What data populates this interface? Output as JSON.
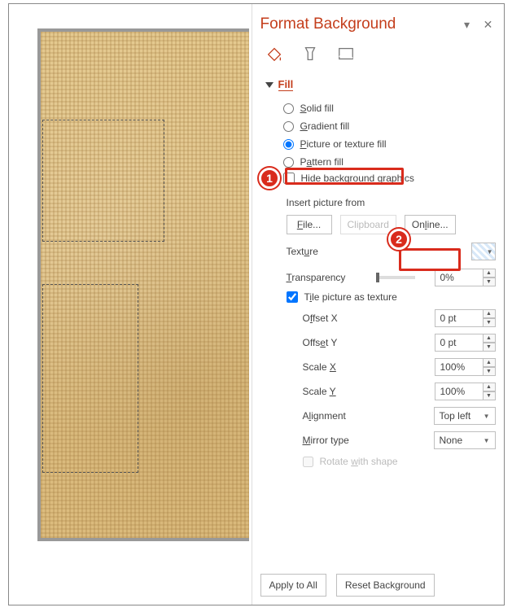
{
  "pane_title": "Format Background",
  "fill_section": {
    "label": "Fill",
    "options": {
      "solid": "Solid fill",
      "gradient": "Gradient fill",
      "picture": "Picture or texture fill",
      "pattern": "Pattern fill"
    },
    "selected": "picture",
    "hide_bg": "Hide background graphics",
    "hide_bg_checked": false
  },
  "insert_picture": {
    "label": "Insert picture from",
    "file_btn": "File...",
    "clipboard_btn": "Clipboard",
    "online_btn": "Online..."
  },
  "texture_label": "Texture",
  "transparency": {
    "label": "Transparency",
    "value": "0%"
  },
  "tile": {
    "label": "Tile picture as texture",
    "checked": true
  },
  "offset_x": {
    "label": "Offset X",
    "value": "0 pt"
  },
  "offset_y": {
    "label": "Offset Y",
    "value": "0 pt"
  },
  "scale_x": {
    "label": "Scale X",
    "value": "100%"
  },
  "scale_y": {
    "label": "Scale Y",
    "value": "100%"
  },
  "alignment": {
    "label": "Alignment",
    "value": "Top left"
  },
  "mirror": {
    "label": "Mirror type",
    "value": "None"
  },
  "rotate": {
    "label": "Rotate with shape"
  },
  "footer": {
    "apply_all": "Apply to All",
    "reset": "Reset Background"
  },
  "annotations": {
    "badge1": "1",
    "badge2": "2"
  }
}
